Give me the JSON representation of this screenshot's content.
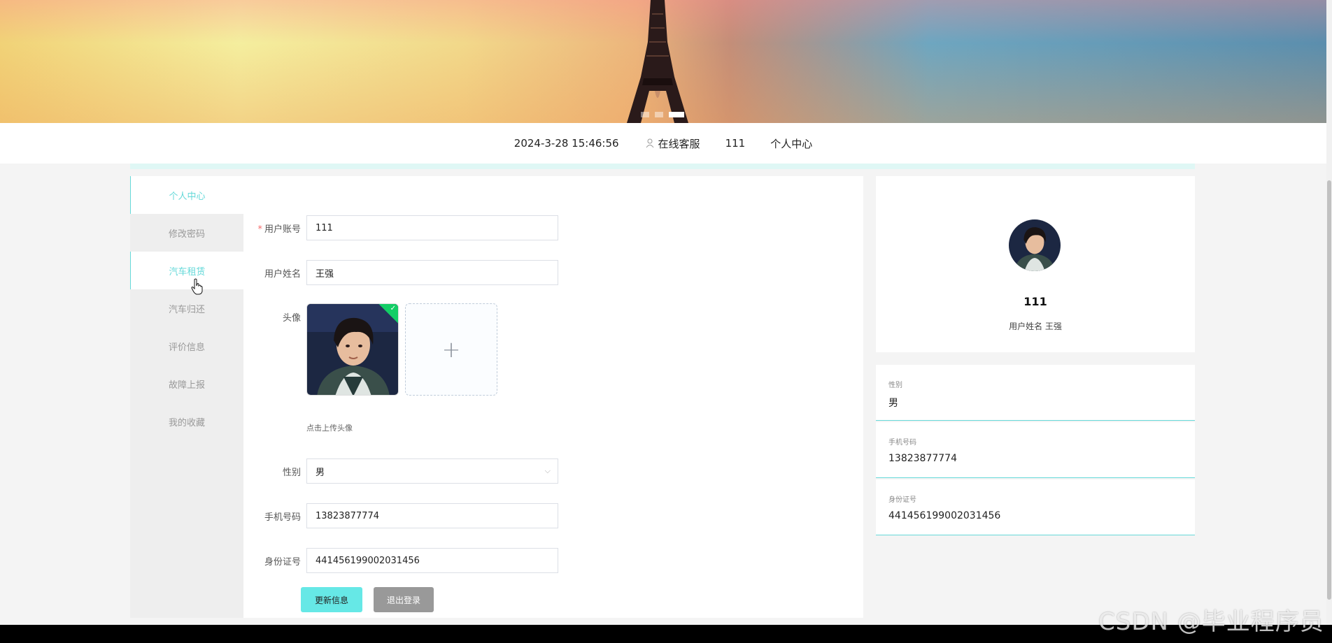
{
  "banner": {
    "slide_count": 3,
    "active_slide": 3
  },
  "navbar": {
    "datetime": "2024-3-28 15:46:56",
    "service_label": "在线客服",
    "user_label": "111",
    "center_label": "个人中心"
  },
  "sidebar": {
    "items": [
      {
        "label": "个人中心"
      },
      {
        "label": "修改密码"
      },
      {
        "label": "汽车租赁"
      },
      {
        "label": "汽车归还"
      },
      {
        "label": "评价信息"
      },
      {
        "label": "故障上报"
      },
      {
        "label": "我的收藏"
      }
    ]
  },
  "form": {
    "account": {
      "label": "用户账号",
      "value": "111",
      "required_mark": "*"
    },
    "name": {
      "label": "用户姓名",
      "value": "王强"
    },
    "avatar": {
      "label": "头像",
      "upload_icon": "+",
      "hint": "点击上传头像"
    },
    "gender": {
      "label": "性别",
      "value": "男"
    },
    "phone": {
      "label": "手机号码",
      "value": "13823877774"
    },
    "idcard": {
      "label": "身份证号",
      "value": "441456199002031456"
    },
    "update_button": "更新信息",
    "logout_button": "退出登录"
  },
  "profile": {
    "username": "111",
    "name_line": "用户姓名 王强",
    "fields": [
      {
        "label": "性别",
        "value": "男"
      },
      {
        "label": "手机号码",
        "value": "13823877774"
      },
      {
        "label": "身份证号",
        "value": "441456199002031456"
      }
    ]
  },
  "watermark": "CSDN @毕业程序员",
  "colors": {
    "accent": "#66e8e6",
    "active_text": "#66d9d9",
    "logout": "#999999",
    "required": "#f56c6c"
  }
}
